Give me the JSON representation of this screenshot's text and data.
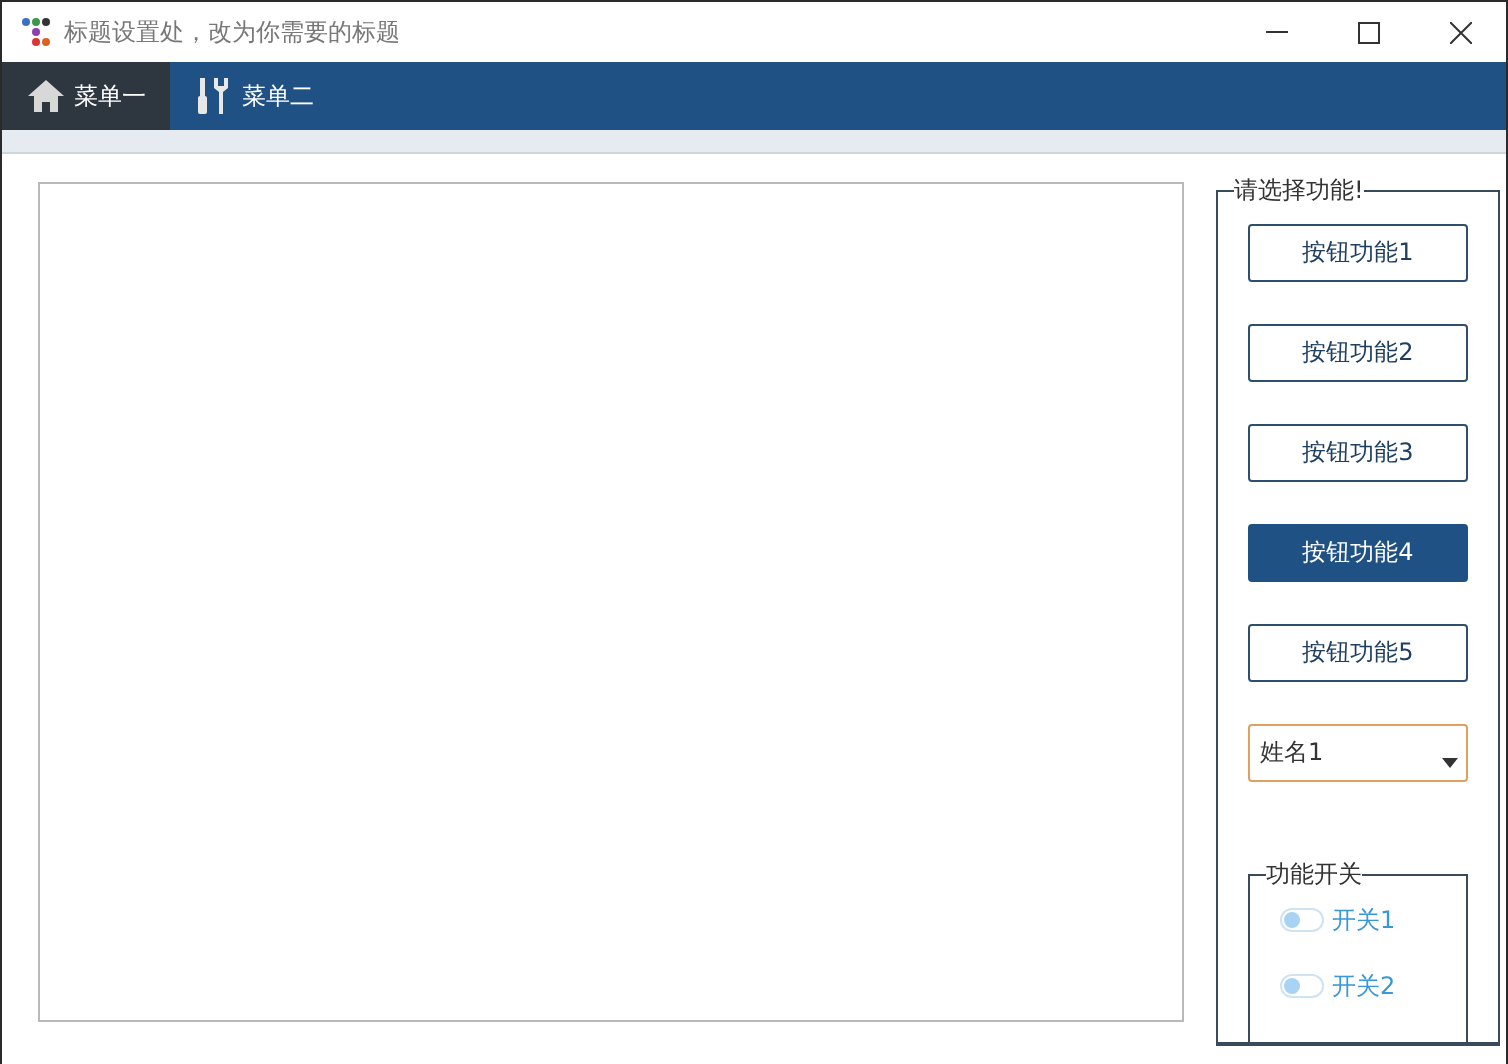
{
  "window": {
    "title": "标题设置处，改为你需要的标题"
  },
  "menu": [
    {
      "label": "菜单一",
      "selected": true
    },
    {
      "label": "菜单二",
      "selected": false
    }
  ],
  "panel": {
    "title": "请选择功能!",
    "buttons": [
      {
        "label": "按钮功能1",
        "selected": false
      },
      {
        "label": "按钮功能2",
        "selected": false
      },
      {
        "label": "按钮功能3",
        "selected": false
      },
      {
        "label": "按钮功能4",
        "selected": true
      },
      {
        "label": "按钮功能5",
        "selected": false
      }
    ],
    "combo": {
      "value": "姓名1"
    },
    "switches": {
      "title": "功能开关",
      "items": [
        {
          "label": "开关1",
          "on": false
        },
        {
          "label": "开关2",
          "on": false
        }
      ]
    }
  }
}
